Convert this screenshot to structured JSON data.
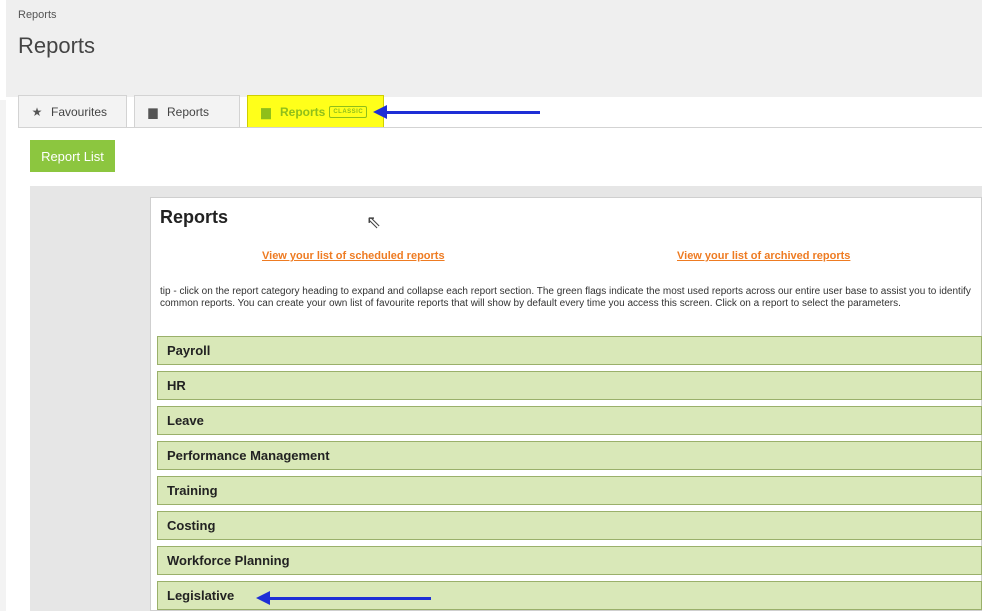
{
  "header": {
    "breadcrumb": "Reports",
    "title": "Reports"
  },
  "tabs": {
    "favourites": "Favourites",
    "reports": "Reports",
    "classic": "Reports",
    "classic_badge": "CLASSIC"
  },
  "toolbar": {
    "report_list": "Report List"
  },
  "classic": {
    "title": "Reports",
    "link_scheduled": "View your list of scheduled reports",
    "link_archived": "View your list of archived reports",
    "tip": "tip - click on the report category heading to expand and collapse each report section. The green flags indicate the most used reports across our entire user base to assist you to identify common reports. You can create your own list of favourite reports that will show by default every time you access this screen. Click on a report to select the parameters.",
    "categories": [
      "Payroll",
      "HR",
      "Leave",
      "Performance Management",
      "Training",
      "Costing",
      "Workforce Planning",
      "Legislative"
    ]
  },
  "colors": {
    "accent_green": "#8cc63f",
    "link_orange": "#ee7b22",
    "category_bg": "#d9e8b8",
    "highlight_yellow": "#ffff1a",
    "annotation_arrow": "#1e2fd6"
  },
  "icons": {
    "favourites": "star-icon",
    "reports": "document-icon",
    "classic": "document-icon",
    "cursor": "mouse-pointer-icon"
  }
}
